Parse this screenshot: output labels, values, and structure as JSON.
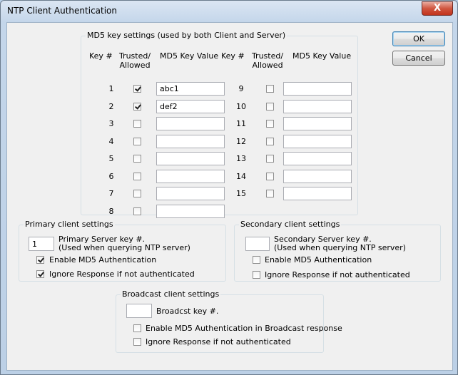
{
  "window": {
    "title": "NTP Client Authentication",
    "close_glyph": "X"
  },
  "buttons": {
    "ok": "OK",
    "cancel": "Cancel"
  },
  "md5": {
    "legend": "MD5 key settings (used by both Client and Server)",
    "headers": {
      "key": "Key #",
      "trusted_line1": "Trusted/",
      "trusted_line2": "Allowed",
      "value": "MD5 Key Value"
    },
    "left_keys": [
      {
        "num": "1",
        "trusted": true,
        "value": "abc1"
      },
      {
        "num": "2",
        "trusted": true,
        "value": "def2"
      },
      {
        "num": "3",
        "trusted": false,
        "value": ""
      },
      {
        "num": "4",
        "trusted": false,
        "value": ""
      },
      {
        "num": "5",
        "trusted": false,
        "value": ""
      },
      {
        "num": "6",
        "trusted": false,
        "value": ""
      },
      {
        "num": "7",
        "trusted": false,
        "value": ""
      },
      {
        "num": "8",
        "trusted": false,
        "value": ""
      }
    ],
    "right_keys": [
      {
        "num": "9",
        "trusted": false,
        "value": ""
      },
      {
        "num": "10",
        "trusted": false,
        "value": ""
      },
      {
        "num": "11",
        "trusted": false,
        "value": ""
      },
      {
        "num": "12",
        "trusted": false,
        "value": ""
      },
      {
        "num": "13",
        "trusted": false,
        "value": ""
      },
      {
        "num": "14",
        "trusted": false,
        "value": ""
      },
      {
        "num": "15",
        "trusted": false,
        "value": ""
      }
    ]
  },
  "primary": {
    "legend": "Primary client settings",
    "key_value": "1",
    "key_label_line1": "Primary Server key #.",
    "key_label_line2": "(Used when querying NTP server)",
    "enable_md5": {
      "label": "Enable MD5 Authentication",
      "checked": true
    },
    "ignore": {
      "label": "Ignore Response if not authenticated",
      "checked": true
    }
  },
  "secondary": {
    "legend": "Secondary client settings",
    "key_value": "",
    "key_label_line1": "Secondary Server key #.",
    "key_label_line2": "(Used when querying NTP server)",
    "enable_md5": {
      "label": "Enable MD5 Authentication",
      "checked": false
    },
    "ignore": {
      "label": "Ignore Response if not authenticated",
      "checked": false
    }
  },
  "broadcast": {
    "legend": "Broadcast client settings",
    "key_value": "",
    "key_label": "Broadcst key #.",
    "enable_md5": {
      "label": "Enable MD5 Authentication in Broadcast response",
      "checked": false
    },
    "ignore": {
      "label": "Ignore Response if not authenticated",
      "checked": false
    }
  }
}
